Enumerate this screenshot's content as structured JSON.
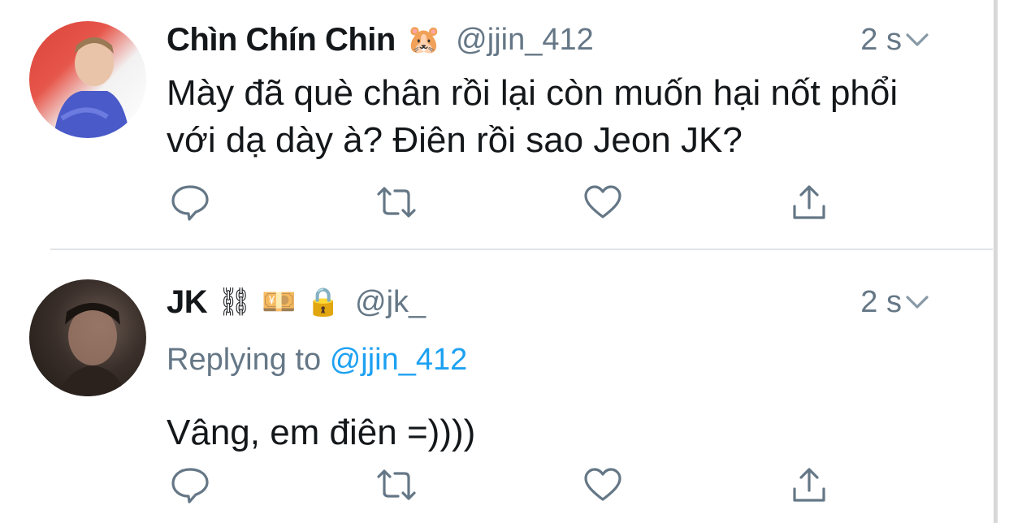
{
  "tweets": [
    {
      "name": "Chìn Chín Chin",
      "name_emoji": "🐹",
      "handle": "@jjin_412",
      "time": "2 s",
      "text": "Mày đã què chân rồi lại còn muốn hại nốt phổi với dạ dày à? Điên rồi sao Jeon JK?",
      "avatar": "profile-photo",
      "actions": [
        "reply-icon",
        "retweet-icon",
        "like-icon",
        "share-icon"
      ]
    },
    {
      "name": "JK",
      "badges": [
        "⛓",
        "💴",
        "🔒"
      ],
      "handle": "@jk_",
      "time": "2 s",
      "replying_label": "Replying to",
      "replying_handle": "@jjin_412",
      "text": "Vâng, em điên =))))",
      "avatar": "profile-photo",
      "actions": [
        "reply-icon",
        "retweet-icon",
        "like-icon",
        "share-icon"
      ]
    }
  ],
  "colors": {
    "text": "#14171a",
    "muted": "#657786",
    "link": "#1da1f2",
    "icon": "#657786"
  }
}
